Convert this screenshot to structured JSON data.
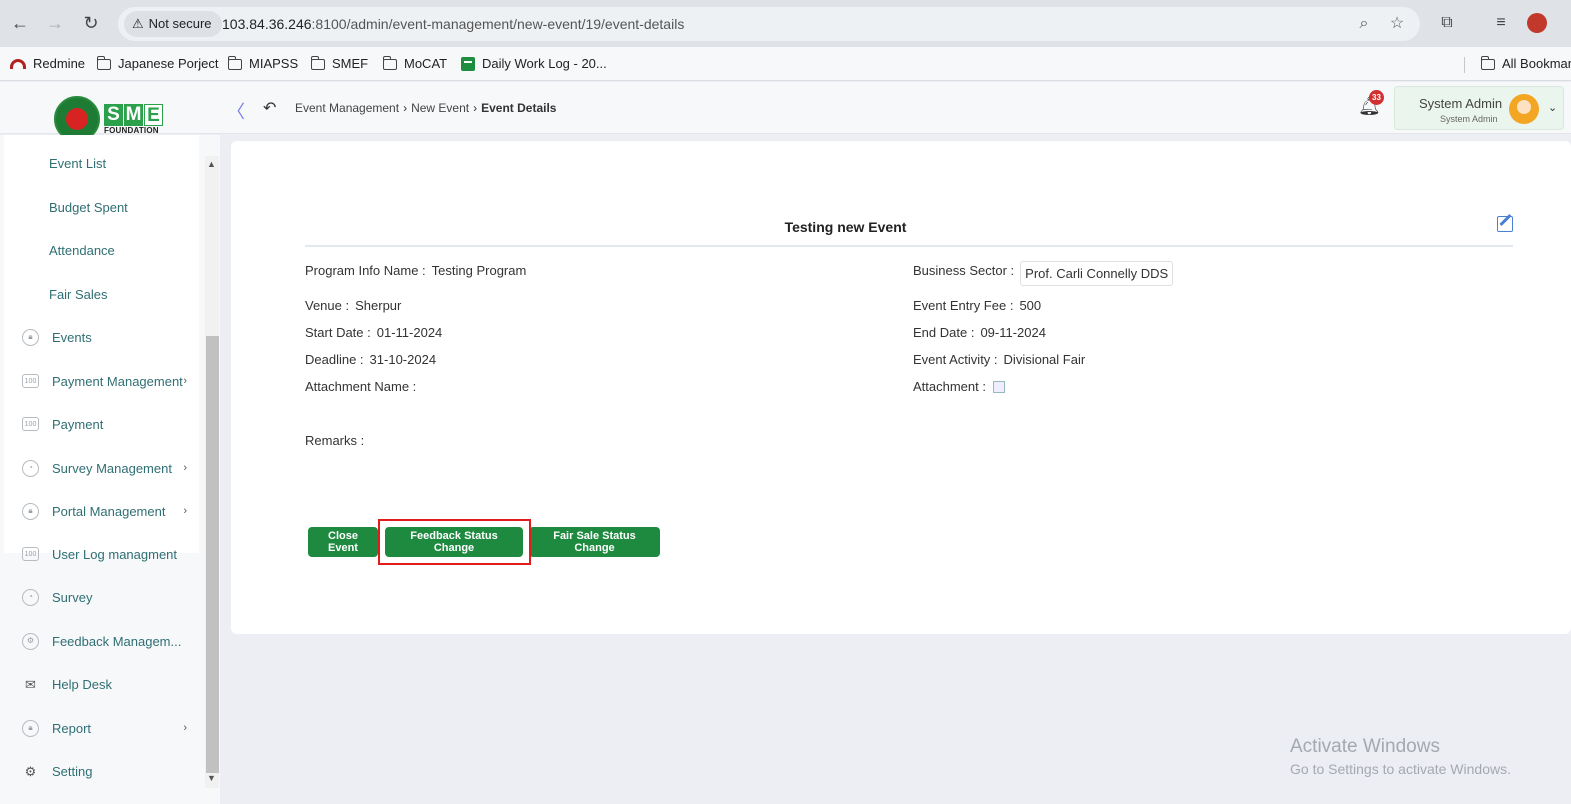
{
  "browser": {
    "security_label": "Not secure",
    "url_host": "103.84.36.246",
    "url_rest": ":8100/admin/event-management/new-event/19/event-details",
    "bookmarks": [
      {
        "label": "Redmine",
        "icon": "redmine-icon"
      },
      {
        "label": "Japanese Porject",
        "icon": "folder-icon"
      },
      {
        "label": "MIAPSS",
        "icon": "folder-icon"
      },
      {
        "label": "SMEF",
        "icon": "folder-icon"
      },
      {
        "label": "MoCAT",
        "icon": "folder-icon"
      },
      {
        "label": "Daily Work Log - 20...",
        "icon": "sheets-icon"
      }
    ],
    "all_bookmarks": "All Bookmar"
  },
  "header": {
    "logo_letters": [
      "S",
      "M",
      "E"
    ],
    "logo_foundation": "FOUNDATION",
    "breadcrumb": [
      "Event Management",
      "New Event",
      "Event Details"
    ],
    "notification_count": "33",
    "user_name": "System Admin",
    "user_role": "System Admin"
  },
  "sidebar": {
    "sub_items": [
      "Event List",
      "Budget Spent",
      "Attendance",
      "Fair Sales"
    ],
    "items": [
      {
        "label": "Events",
        "icon": "lock-circle-icon",
        "chevron": false
      },
      {
        "label": "Payment Management",
        "icon": "money-box-icon",
        "chevron": true
      },
      {
        "label": "Payment",
        "icon": "money-box-icon",
        "chevron": false
      },
      {
        "label": "Survey Management",
        "icon": "pie-chart-icon",
        "chevron": true
      },
      {
        "label": "Portal Management",
        "icon": "lock-circle-icon",
        "chevron": true
      },
      {
        "label": "User Log managment",
        "icon": "money-box-icon",
        "chevron": false
      },
      {
        "label": "Survey",
        "icon": "pie-chart-icon",
        "chevron": false
      },
      {
        "label": "Feedback Managem...",
        "icon": "feedback-icon",
        "chevron": false
      },
      {
        "label": "Help Desk",
        "icon": "mail-icon",
        "chevron": false
      },
      {
        "label": "Report",
        "icon": "lock-circle-icon",
        "chevron": true
      },
      {
        "label": "Setting",
        "icon": "gear-icon",
        "chevron": false
      }
    ]
  },
  "event": {
    "title": "Testing new Event",
    "program_info_label": "Program Info Name :",
    "program_info": "Testing Program",
    "business_sector_label": "Business Sector :",
    "business_sector": "Prof. Carli Connelly DDS",
    "venue_label": "Venue :",
    "venue": "Sherpur",
    "entry_fee_label": "Event Entry Fee :",
    "entry_fee": "500",
    "start_date_label": "Start Date :",
    "start_date": "01-11-2024",
    "end_date_label": "End Date :",
    "end_date": "09-11-2024",
    "deadline_label": "Deadline :",
    "deadline": "31-10-2024",
    "activity_label": "Event Activity :",
    "activity": "Divisional Fair",
    "attachment_name_label": "Attachment Name :",
    "attachment_label": "Attachment :",
    "remarks_label": "Remarks :"
  },
  "actions": {
    "close_event": "Close Event",
    "feedback_status": "Feedback Status Change",
    "fair_sale_status": "Fair Sale Status Change"
  },
  "watermark": {
    "line1": "Activate Windows",
    "line2": "Go to Settings to activate Windows."
  }
}
